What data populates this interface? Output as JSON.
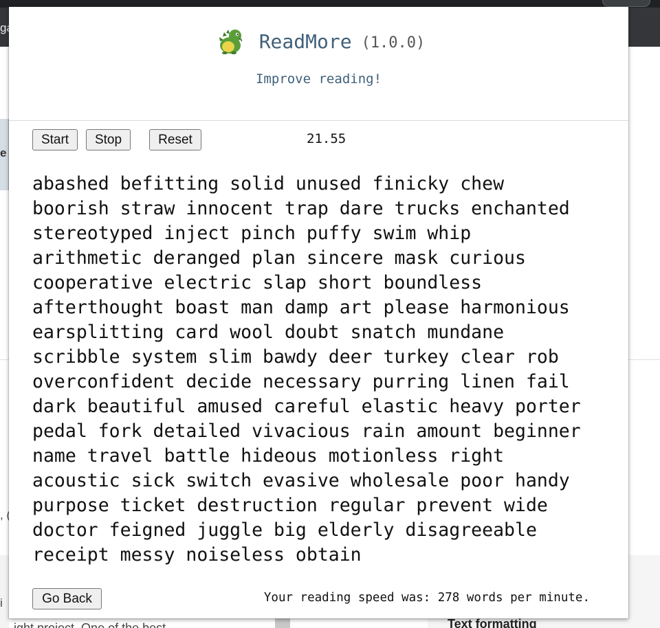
{
  "background": {
    "tabstrip_fragment": "ga",
    "left_panel_fragment": "e",
    "left_fragment_1": ", (",
    "left_fragment_2": "i",
    "bottom_left_text": "ight project. One of the best",
    "bottom_right_heading": "Text formatting"
  },
  "popup": {
    "logo_icon": "dinosaur-logo-icon",
    "title": "ReadMore",
    "version": "(1.0.0)",
    "subtitle": "Improve reading!",
    "controls": {
      "start_label": "Start",
      "stop_label": "Stop",
      "reset_label": "Reset",
      "timer": "21.55"
    },
    "word_lines": [
      "abashed befitting solid unused finicky chew",
      "boorish straw innocent trap dare trucks enchanted",
      "stereotyped inject pinch puffy swim whip",
      "arithmetic deranged plan sincere mask curious",
      "cooperative electric slap short boundless",
      "afterthought boast man damp art please harmonious",
      "earsplitting card wool doubt snatch mundane",
      "scribble system slim bawdy deer turkey clear rob",
      "overconfident decide necessary purring linen fail",
      "dark beautiful amused careful elastic heavy porter",
      "pedal fork detailed vivacious rain amount beginner",
      "name travel battle hideous motionless right",
      "acoustic sick switch evasive wholesale poor handy",
      "purpose ticket destruction regular prevent wide",
      "doctor feigned juggle big elderly disagreeable",
      "receipt messy noiseless obtain"
    ],
    "footer": {
      "back_label": "Go Back",
      "speed_text": "Your reading speed was: 278 words per minute."
    }
  },
  "colors": {
    "title": "#3f607a",
    "chrome_dark": "#202124",
    "tabstrip": "#35363a"
  }
}
